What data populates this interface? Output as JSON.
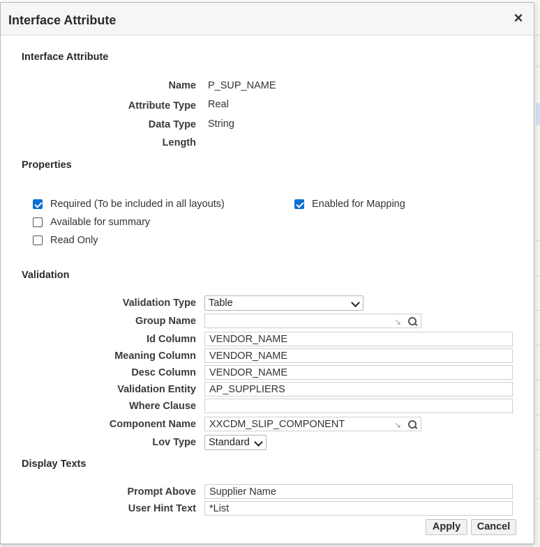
{
  "dialog": {
    "title": "Interface Attribute",
    "close_glyph": "×"
  },
  "interface_attribute": {
    "section_title": "Interface Attribute",
    "rows": [
      {
        "label": "Name",
        "value": "P_SUP_NAME"
      },
      {
        "label": "Attribute Type",
        "value": "Real"
      },
      {
        "label": "Data Type",
        "value": "String"
      },
      {
        "label": "Length",
        "value": ""
      }
    ]
  },
  "properties": {
    "section_title": "Properties",
    "required": {
      "label": "Required (To be included in all layouts)",
      "checked": true
    },
    "enabled_for_mapping": {
      "label": "Enabled for Mapping",
      "checked": true
    },
    "available_for_summary": {
      "label": "Available for summary",
      "checked": false
    },
    "read_only": {
      "label": "Read Only",
      "checked": false
    }
  },
  "validation": {
    "section_title": "Validation",
    "validation_type": {
      "label": "Validation Type",
      "value": "Table"
    },
    "group_name": {
      "label": "Group Name",
      "value": ""
    },
    "id_column": {
      "label": "Id Column",
      "value": "VENDOR_NAME"
    },
    "meaning_column": {
      "label": "Meaning Column",
      "value": "VENDOR_NAME"
    },
    "desc_column": {
      "label": "Desc Column",
      "value": "VENDOR_NAME"
    },
    "validation_entity": {
      "label": "Validation Entity",
      "value": "AP_SUPPLIERS"
    },
    "where_clause": {
      "label": "Where Clause",
      "value": ""
    },
    "component_name": {
      "label": "Component Name",
      "value": "XXCDM_SLIP_COMPONENT"
    },
    "lov_type": {
      "label": "Lov Type",
      "value": "Standard"
    }
  },
  "display_texts": {
    "section_title": "Display Texts",
    "prompt_above": {
      "label": "Prompt Above",
      "value": "Supplier Name"
    },
    "user_hint_text": {
      "label": "User Hint Text",
      "value": "*List"
    }
  },
  "buttons": {
    "apply": "Apply",
    "cancel": "Cancel"
  },
  "icons": {
    "close": "close-icon",
    "lov_clear": "clear-corner-icon",
    "lov_search": "search-icon",
    "dropdown": "chevron-down-icon",
    "checkbox_checked_color": "#0b6ed4"
  }
}
